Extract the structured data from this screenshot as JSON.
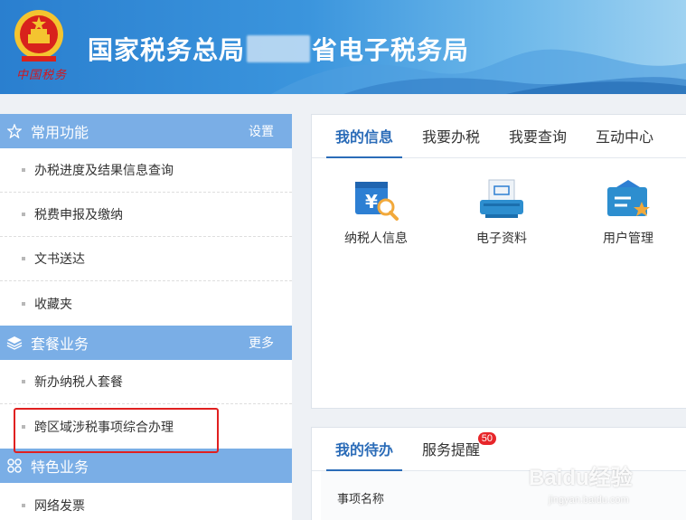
{
  "header": {
    "title_part1": "国家税务总局",
    "title_part2": "省电子税务局",
    "emblem_text": "中国税务"
  },
  "sidebar": {
    "sections": [
      {
        "label": "常用功能",
        "action": "设置",
        "icon": "star-icon",
        "items": [
          "办税进度及结果信息查询",
          "税费申报及缴纳",
          "文书送达",
          "收藏夹"
        ]
      },
      {
        "label": "套餐业务",
        "action": "更多",
        "icon": "layers-icon",
        "items": [
          "新办纳税人套餐",
          "跨区域涉税事项综合办理"
        ]
      },
      {
        "label": "特色业务",
        "action": "",
        "icon": "grid-icon",
        "items": [
          "网络发票"
        ]
      }
    ]
  },
  "info_panel": {
    "tabs": [
      "我的信息",
      "我要办税",
      "我要查询",
      "互动中心"
    ],
    "active_tab": "我的信息",
    "tiles": [
      {
        "label": "纳税人信息",
        "icon": "taxpayer-info-icon"
      },
      {
        "label": "电子资料",
        "icon": "electronic-document-icon"
      },
      {
        "label": "用户管理",
        "icon": "user-management-icon"
      }
    ]
  },
  "todo_panel": {
    "tabs": [
      "我的待办",
      "服务提醒"
    ],
    "active_tab": "我的待办",
    "reminder_badge": "50",
    "column_header": "事项名称"
  },
  "watermark": {
    "text": "Baidu经验",
    "sub": "jingyan.baidu.com"
  },
  "colors": {
    "accent": "#2b6cb8",
    "section_bg": "#7aaee6",
    "highlight": "#e02020",
    "badge": "#e7262a"
  }
}
